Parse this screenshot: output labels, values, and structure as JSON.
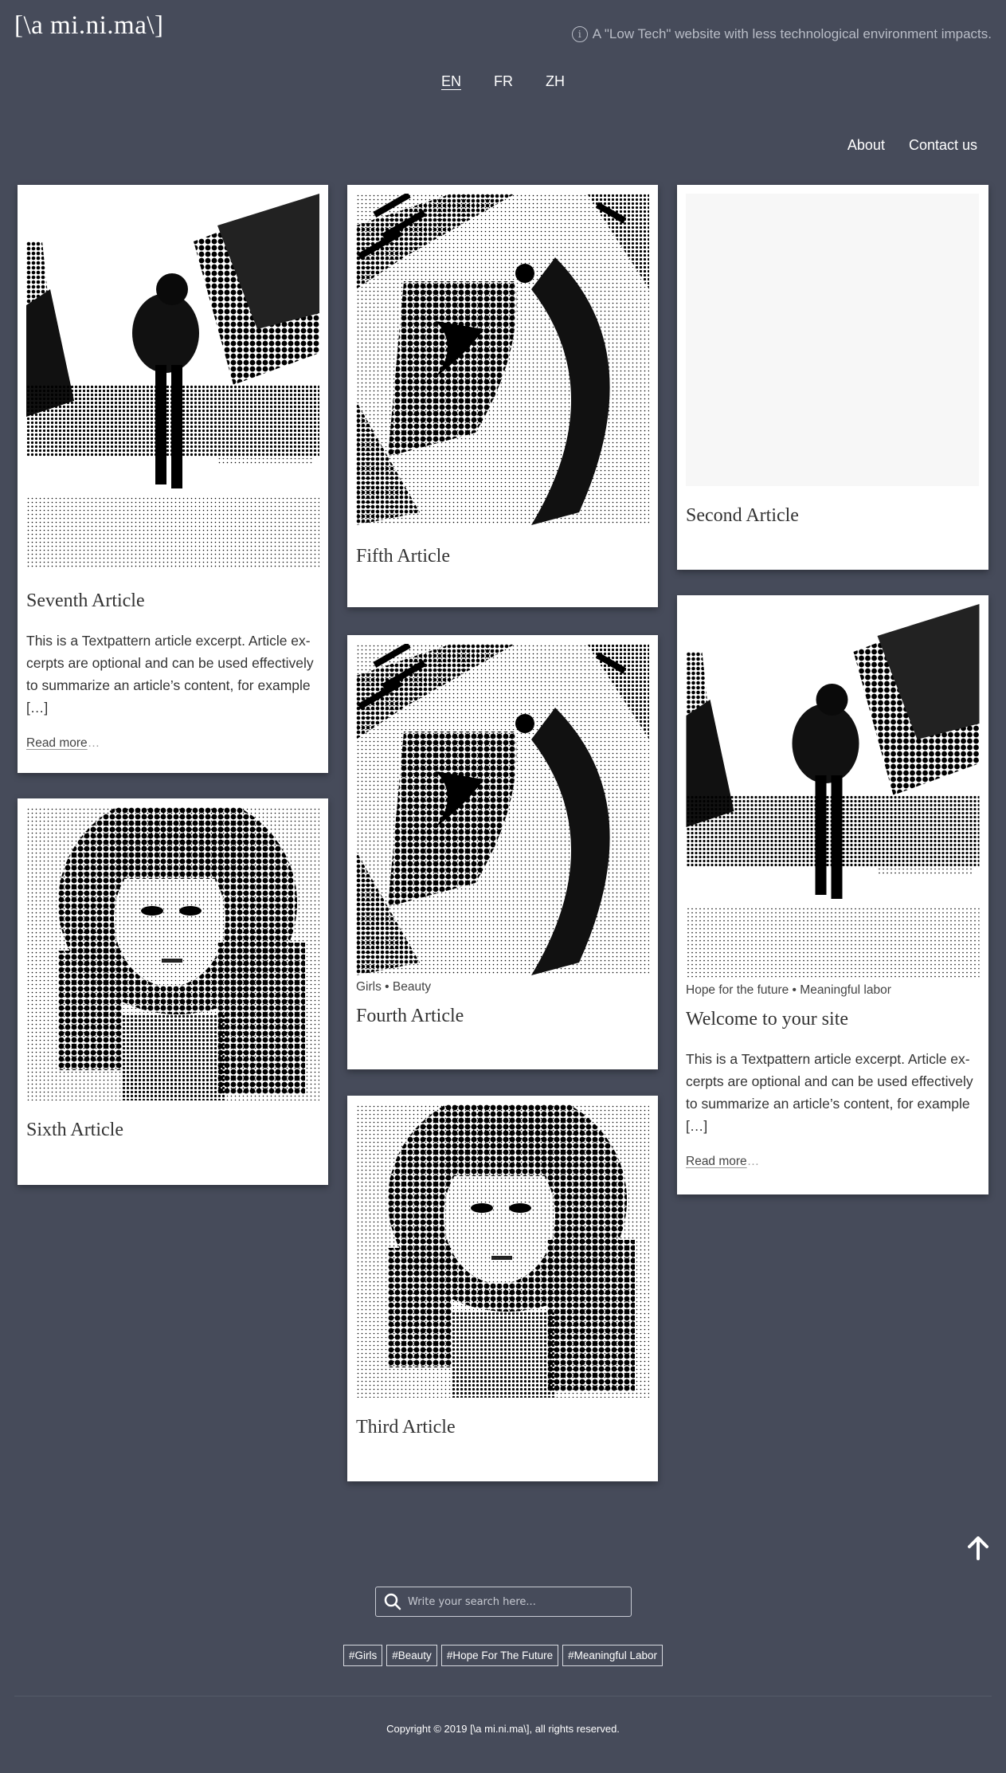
{
  "header": {
    "logo": "[\\a mi.ni.ma\\]",
    "tagline": "A \"Low Tech\" website with less technological environment impacts."
  },
  "languages": [
    "EN",
    "FR",
    "ZH"
  ],
  "nav": {
    "about": "About",
    "contact": "Contact us"
  },
  "articles": {
    "seventh": {
      "title": "Seventh Article",
      "excerpt": "This is a Textpattern article excerpt. Article ex­cerpts are optional and can be used effectively to summarize an article’s content, for example […]",
      "read_more": "Read more",
      "ellipsis": "…"
    },
    "sixth": {
      "title": "Sixth Article"
    },
    "fifth": {
      "title": "Fifth Article"
    },
    "fourth": {
      "title": "Fourth Article",
      "tags": "Girls • Beauty"
    },
    "third": {
      "title": "Third Article"
    },
    "second": {
      "title": "Second Article"
    },
    "welcome": {
      "title": "Welcome to your site",
      "tags": "Hope for the future • Meaningful labor",
      "excerpt": "This is a Textpattern article excerpt. Article ex­cerpts are optional and can be used effectively to summarize an article’s content, for example […]",
      "read_more": "Read more",
      "ellipsis": "…"
    }
  },
  "search": {
    "placeholder": "Write your search here..."
  },
  "hashtags": [
    "#Girls",
    "#Beauty",
    "#Hope For The Future",
    "#Meaningful Labor"
  ],
  "footer": {
    "copyright": "Copyright © 2019 [\\a mi.ni.ma\\], all rights reserved."
  }
}
